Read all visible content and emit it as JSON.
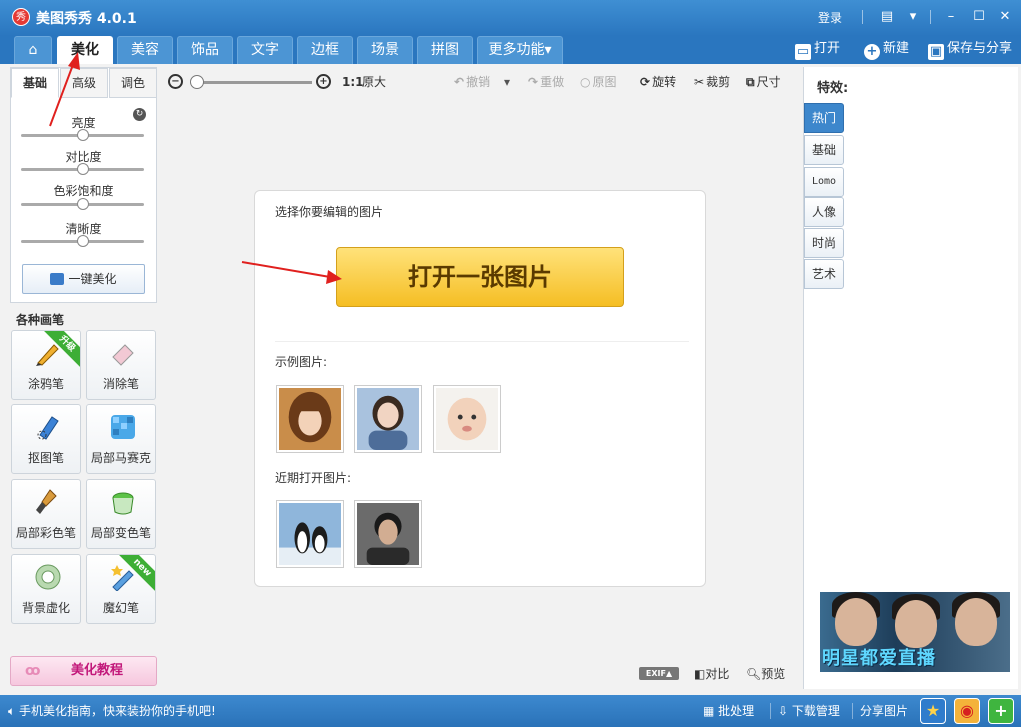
{
  "window": {
    "title": "美图秀秀 4.0.1",
    "logo_text": "秀",
    "login": "登录"
  },
  "nav": {
    "tabs": [
      "美化",
      "美容",
      "饰品",
      "文字",
      "边框",
      "场景",
      "拼图"
    ],
    "more": "更多功能",
    "actions": {
      "open": "打开",
      "new": "新建",
      "save_share": "保存与分享"
    }
  },
  "adjust": {
    "tabs": [
      "基础",
      "高级",
      "调色"
    ],
    "sliders": [
      {
        "label": "亮度",
        "value": 0.5
      },
      {
        "label": "对比度",
        "value": 0.5
      },
      {
        "label": "色彩饱和度",
        "value": 0.5
      },
      {
        "label": "清晰度",
        "value": 0.5
      }
    ],
    "one_click": "一键美化"
  },
  "pens": {
    "title": "各种画笔",
    "items": [
      {
        "label": "涂鸦笔",
        "badge": "升级",
        "icon": "pen-icon"
      },
      {
        "label": "消除笔",
        "badge": "",
        "icon": "eraser-icon"
      },
      {
        "label": "抠图笔",
        "badge": "",
        "icon": "cutout-pen-icon"
      },
      {
        "label": "局部马赛克",
        "badge": "",
        "icon": "mosaic-icon"
      },
      {
        "label": "局部彩色笔",
        "badge": "",
        "icon": "brush-icon"
      },
      {
        "label": "局部变色笔",
        "badge": "",
        "icon": "paint-bucket-icon"
      },
      {
        "label": "背景虚化",
        "badge": "",
        "icon": "blur-icon"
      },
      {
        "label": "魔幻笔",
        "badge": "new",
        "icon": "magic-wand-icon"
      }
    ],
    "tutorial": "美化教程"
  },
  "toolbar": {
    "zoom_ratio": "1:1",
    "original_size": "原大",
    "undo": "撤销",
    "redo": "重做",
    "original": "原图",
    "rotate": "旋转",
    "crop": "裁剪",
    "resize": "尺寸"
  },
  "canvas": {
    "prompt": "选择你要编辑的图片",
    "open_button": "打开一张图片",
    "examples_label": "示例图片:",
    "recent_label": "近期打开图片:"
  },
  "effects": {
    "title": "特效:",
    "tabs": [
      "热门",
      "基础",
      "Lomo",
      "人像",
      "时尚",
      "艺术"
    ],
    "ad_text": "明星都爱直播"
  },
  "bottom_tools": {
    "exif": "EXIF▲",
    "compare": "对比",
    "preview": "预览"
  },
  "statusbar": {
    "message": "手机美化指南，快来装扮你的手机吧!",
    "batch": "批处理",
    "download": "下载管理",
    "share": "分享图片"
  },
  "colors": {
    "accent": "#2a76bf",
    "open_button": "#f5be24",
    "annotation_arrow": "#e0201e"
  }
}
